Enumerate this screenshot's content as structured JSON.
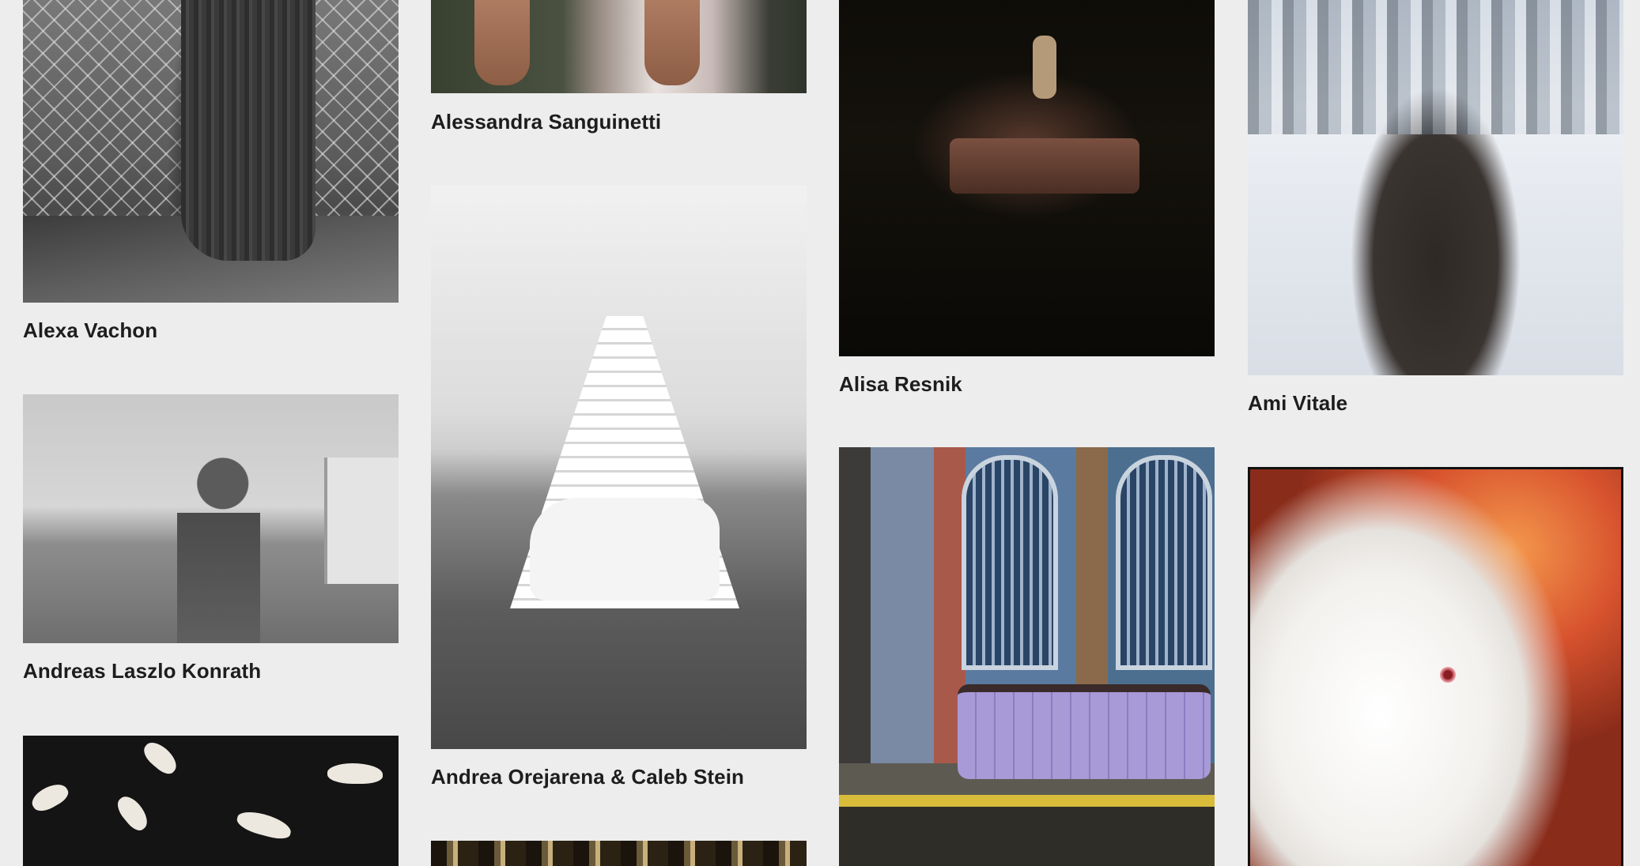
{
  "gallery": {
    "items": [
      {
        "id": "alexa",
        "name": "Alexa Vachon"
      },
      {
        "id": "alessandra",
        "name": "Alessandra Sanguinetti"
      },
      {
        "id": "alisa",
        "name": "Alisa Resnik"
      },
      {
        "id": "ami",
        "name": "Ami Vitale"
      },
      {
        "id": "andreas",
        "name": "Andreas Laszlo Konrath"
      },
      {
        "id": "andrea-caleb",
        "name": "Andrea Orejarena & Caleb Stein"
      }
    ]
  },
  "colors": {
    "background": "#ededed",
    "text": "#1d1d1d"
  }
}
